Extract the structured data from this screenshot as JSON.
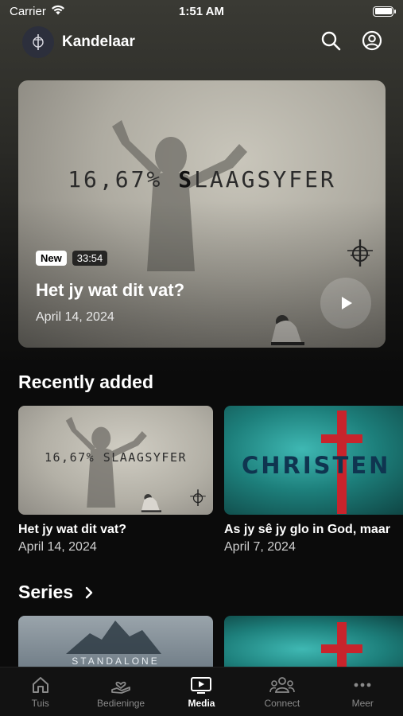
{
  "status_bar": {
    "carrier": "Carrier",
    "time": "1:51 AM"
  },
  "header": {
    "title": "Kandelaar"
  },
  "hero": {
    "artwork_text_prefix": "16,67% ",
    "artwork_text_bold": "S",
    "artwork_text_rest": "LAAGSYFER",
    "badge_new": "New",
    "duration": "33:54",
    "title": "Het jy wat dit vat?",
    "date": "April 14, 2024"
  },
  "recently_added": {
    "heading": "Recently added",
    "items": [
      {
        "title": "Het jy wat dit vat?",
        "date": "April 14, 2024",
        "art_text": "16,67% SLAAGSYFER"
      },
      {
        "title": "As jy sê jy glo in God, maar",
        "date": "April 7, 2024",
        "art_text": "CHRISTEN"
      }
    ]
  },
  "series": {
    "heading": "Series",
    "items": [
      {
        "art_text": "STANDALONE"
      }
    ]
  },
  "tab_bar": {
    "tabs": [
      {
        "label": "Tuis",
        "icon": "home-icon"
      },
      {
        "label": "Bedieninge",
        "icon": "hand-heart-icon"
      },
      {
        "label": "Media",
        "icon": "tv-play-icon"
      },
      {
        "label": "Connect",
        "icon": "group-icon"
      },
      {
        "label": "Meer",
        "icon": "more-icon"
      }
    ],
    "active": "Media"
  },
  "colors": {
    "background": "#0b0b0b",
    "tab_active": "#ffffff",
    "tab_inactive": "#8a8a8a"
  }
}
